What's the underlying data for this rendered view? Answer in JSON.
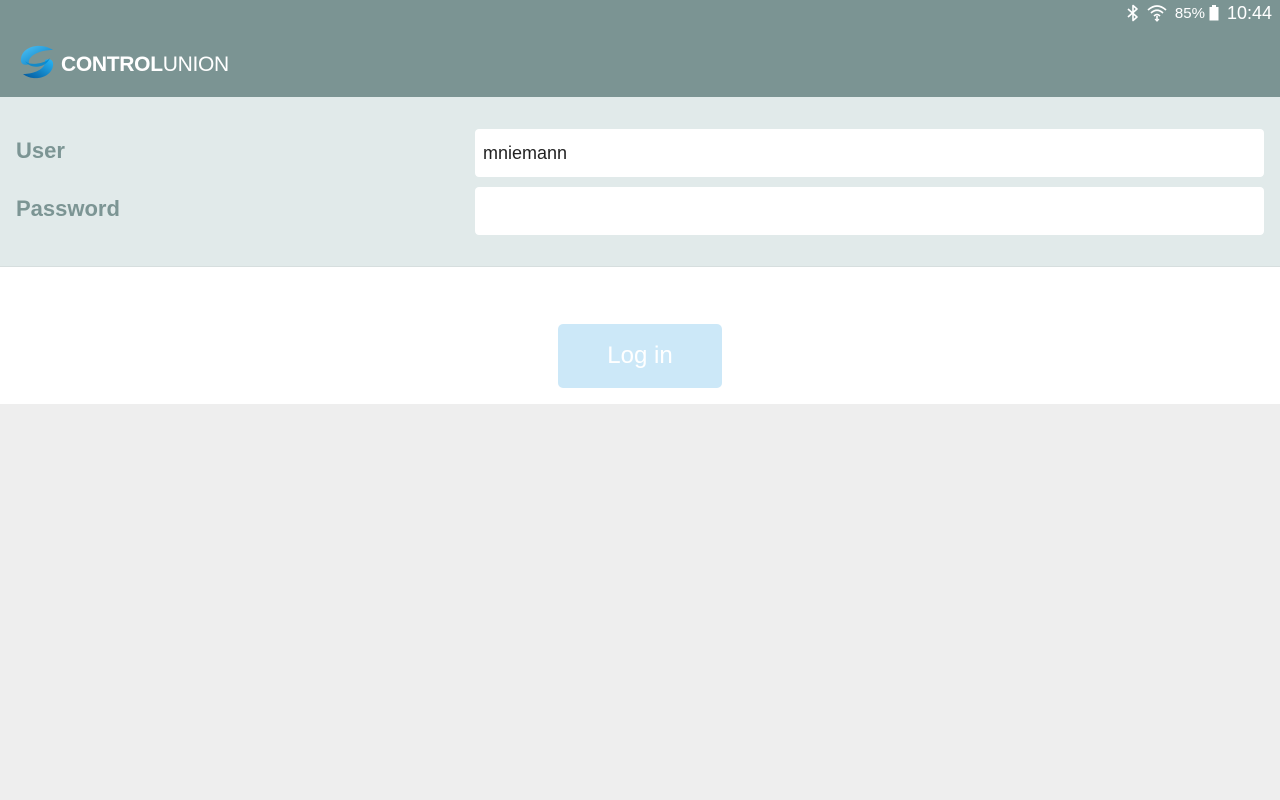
{
  "status_bar": {
    "battery_percent": "85%",
    "time": "10:44",
    "icons": [
      "bluetooth-icon",
      "wifi-icon",
      "battery-icon"
    ]
  },
  "header": {
    "logo_bold": "CONTROL",
    "logo_light": "UNION"
  },
  "form": {
    "user_label": "User",
    "user_value": "mniemann",
    "password_label": "Password",
    "password_value": ""
  },
  "actions": {
    "login_label": "Log in"
  },
  "colors": {
    "header_bg": "#7b9493",
    "form_bg": "#e1eaea",
    "label": "#7c9594",
    "button_bg": "#cce8f8",
    "page_bg": "#eeeeee"
  }
}
